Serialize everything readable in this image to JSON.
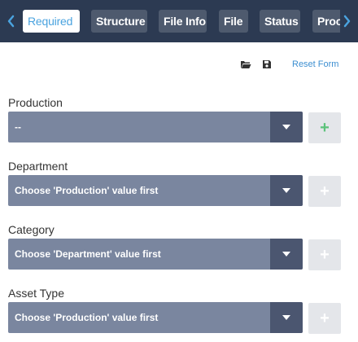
{
  "tabs": [
    {
      "label": "Required",
      "active": true
    },
    {
      "label": "Structure",
      "active": false
    },
    {
      "label": "File Info",
      "active": false
    },
    {
      "label": "File",
      "active": false
    },
    {
      "label": "Status",
      "active": false
    },
    {
      "label": "Proc",
      "active": false
    }
  ],
  "toolbar": {
    "open_icon": "folder-open-icon",
    "save_icon": "save-icon",
    "reset_label": "Reset Form"
  },
  "fields": [
    {
      "label": "Production",
      "value": "--",
      "add_enabled": true
    },
    {
      "label": "Department",
      "value": "Choose 'Production' value first",
      "add_enabled": false
    },
    {
      "label": "Category",
      "value": "Choose 'Department' value first",
      "add_enabled": false
    },
    {
      "label": "Asset Type",
      "value": "Choose 'Production' value first",
      "add_enabled": false
    }
  ],
  "colors": {
    "header_bg": "#2c3a52",
    "accent_blue": "#4aa3df",
    "select_bg": "#7a869f",
    "caret_bg": "#4b5670",
    "add_enabled": "#5cc27a",
    "add_disabled": "#ffffff"
  }
}
